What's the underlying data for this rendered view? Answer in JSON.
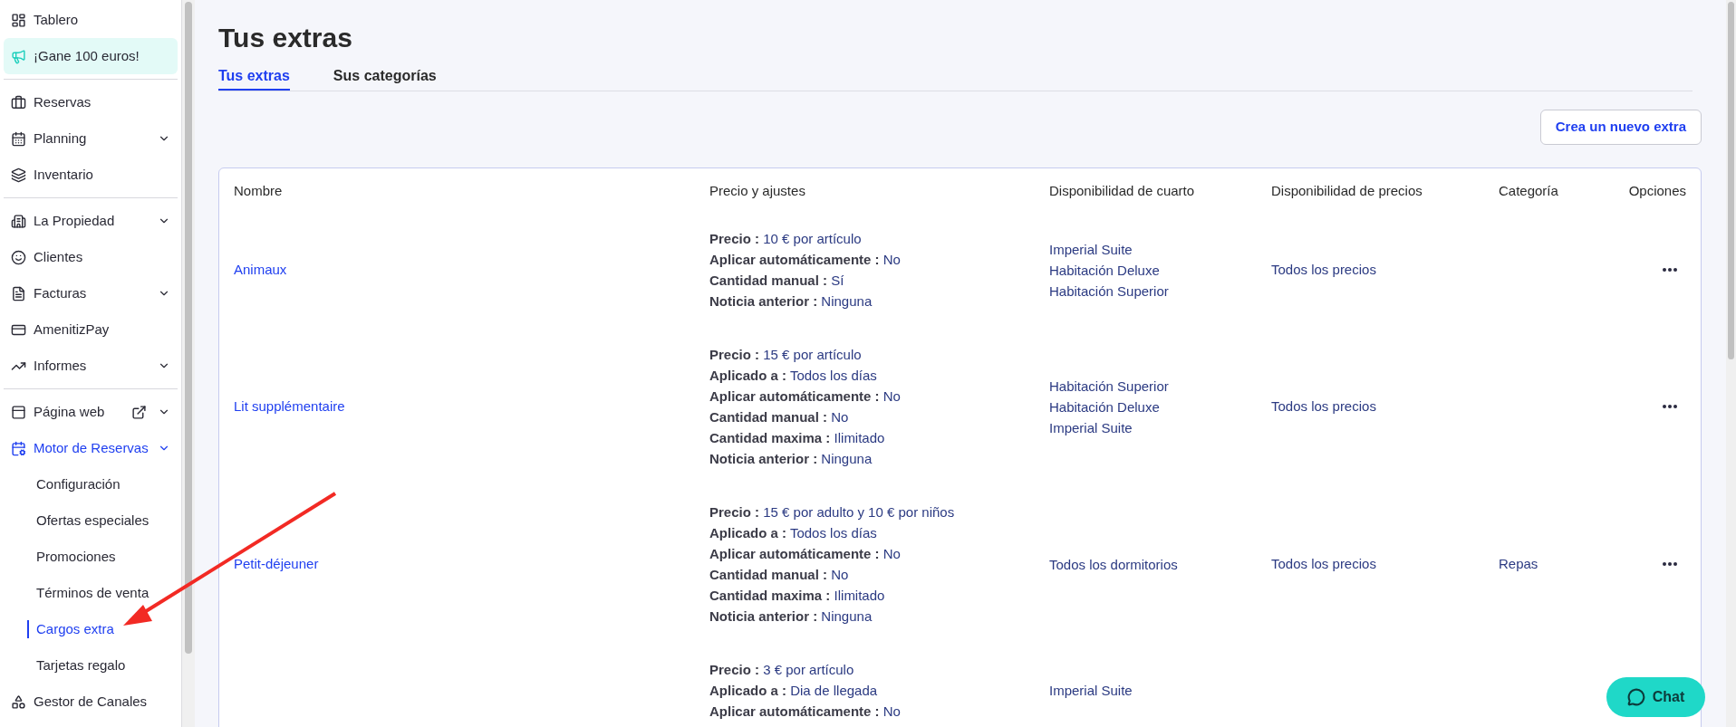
{
  "sidebar": {
    "sections": [
      {
        "items": [
          {
            "label": "Tablero",
            "kind": "link",
            "has_submenu": false,
            "external": false,
            "active": false
          },
          {
            "label": "¡Gane 100 euros!",
            "kind": "promo",
            "has_submenu": false,
            "external": false,
            "active": false
          }
        ]
      },
      {
        "items": [
          {
            "label": "Reservas",
            "kind": "link",
            "has_submenu": false,
            "external": false,
            "active": false
          },
          {
            "label": "Planning",
            "kind": "link",
            "has_submenu": true,
            "external": false,
            "active": false
          },
          {
            "label": "Inventario",
            "kind": "link",
            "has_submenu": false,
            "external": false,
            "active": false
          }
        ]
      },
      {
        "items": [
          {
            "label": "La Propiedad",
            "kind": "link",
            "has_submenu": true,
            "external": false,
            "active": false
          },
          {
            "label": "Clientes",
            "kind": "link",
            "has_submenu": false,
            "external": false,
            "active": false
          },
          {
            "label": "Facturas",
            "kind": "link",
            "has_submenu": true,
            "external": false,
            "active": false
          },
          {
            "label": "AmenitizPay",
            "kind": "link",
            "has_submenu": false,
            "external": false,
            "active": false
          },
          {
            "label": "Informes",
            "kind": "link",
            "has_submenu": true,
            "external": false,
            "active": false
          }
        ]
      },
      {
        "items": [
          {
            "label": "Página web",
            "kind": "link",
            "has_submenu": true,
            "external": true,
            "active": false
          },
          {
            "label": "Motor de Reservas",
            "kind": "link",
            "has_submenu": true,
            "external": false,
            "active": true,
            "children": [
              {
                "label": "Configuración",
                "selected": false
              },
              {
                "label": "Ofertas especiales",
                "selected": false
              },
              {
                "label": "Promociones",
                "selected": false
              },
              {
                "label": "Términos de venta",
                "selected": false
              },
              {
                "label": "Cargos extra",
                "selected": true
              },
              {
                "label": "Tarjetas regalo",
                "selected": false
              }
            ]
          },
          {
            "label": "Gestor de Canales",
            "kind": "link",
            "has_submenu": false,
            "external": false,
            "active": false
          }
        ]
      }
    ]
  },
  "page": {
    "title": "Tus extras",
    "tabs": [
      {
        "label": "Tus extras",
        "selected": true
      },
      {
        "label": "Sus categorías",
        "selected": false
      }
    ],
    "new_button": "Crea un nuevo extra"
  },
  "table": {
    "columns": [
      "Nombre",
      "Precio y ajustes",
      "Disponibilidad de cuarto",
      "Disponibilidad de precios",
      "Categoría",
      "Opciones"
    ],
    "rows": [
      {
        "name": "Animaux",
        "settings": [
          {
            "label": "Precio :",
            "value": "10 € por artículo"
          },
          {
            "label": "Aplicar automáticamente :",
            "value": "No"
          },
          {
            "label": "Cantidad manual :",
            "value": "Sí"
          },
          {
            "label": "Noticia anterior :",
            "value": "Ninguna"
          }
        ],
        "rooms": [
          "Imperial Suite",
          "Habitación Deluxe",
          "Habitación Superior"
        ],
        "prices": [
          "Todos los precios"
        ],
        "category": "",
        "has_options": true
      },
      {
        "name": "Lit supplémentaire",
        "settings": [
          {
            "label": "Precio :",
            "value": "15 € por artículo"
          },
          {
            "label": "Aplicado a :",
            "value": "Todos los días"
          },
          {
            "label": "Aplicar automáticamente :",
            "value": "No"
          },
          {
            "label": "Cantidad manual :",
            "value": "No"
          },
          {
            "label": "Cantidad maxima :",
            "value": "Ilimitado"
          },
          {
            "label": "Noticia anterior :",
            "value": "Ninguna"
          }
        ],
        "rooms": [
          "Habitación Superior",
          "Habitación Deluxe",
          "Imperial Suite"
        ],
        "prices": [
          "Todos los precios"
        ],
        "category": "",
        "has_options": true
      },
      {
        "name": "Petit-déjeuner",
        "settings": [
          {
            "label": "Precio :",
            "value": "15 € por adulto y 10 € por niños"
          },
          {
            "label": "Aplicado a :",
            "value": "Todos los días"
          },
          {
            "label": "Aplicar automáticamente :",
            "value": "No"
          },
          {
            "label": "Cantidad manual :",
            "value": "No"
          },
          {
            "label": "Cantidad maxima :",
            "value": "Ilimitado"
          },
          {
            "label": "Noticia anterior :",
            "value": "Ninguna"
          }
        ],
        "rooms": [
          "Todos los dormitorios"
        ],
        "prices": [
          "Todos los precios"
        ],
        "category": "Repas",
        "has_options": true
      },
      {
        "settings": [
          {
            "label": "Precio :",
            "value": "3 € por artículo"
          },
          {
            "label": "Aplicado a :",
            "value": "Dia de llegada"
          },
          {
            "label": "Aplicar automáticamente :",
            "value": "No"
          }
        ],
        "rooms": [
          "Imperial Suite"
        ],
        "prices": [],
        "category": ""
      }
    ]
  },
  "chat": {
    "label": "Chat"
  }
}
